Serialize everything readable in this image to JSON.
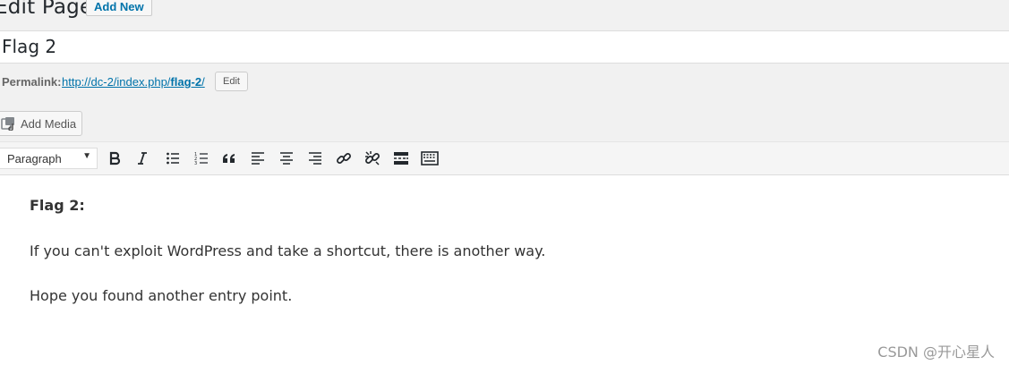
{
  "header": {
    "title": "Edit Page",
    "add_new_label": "Add New"
  },
  "post": {
    "title": "Flag 2"
  },
  "permalink": {
    "label": "Permalink:",
    "url_base": "http://dc-2/index.php/",
    "slug": "flag-2",
    "url_suffix": "/",
    "edit_label": "Edit"
  },
  "media": {
    "add_media_label": "Add Media"
  },
  "toolbar": {
    "format_value": "Paragraph",
    "buttons": [
      "bold-icon",
      "italic-icon",
      "bulleted-list-icon",
      "numbered-list-icon",
      "blockquote-icon",
      "align-left-icon",
      "align-center-icon",
      "align-right-icon",
      "insert-link-icon",
      "remove-link-icon",
      "read-more-icon",
      "toolbar-toggle-icon"
    ]
  },
  "content": {
    "heading": "Flag 2:",
    "paragraph1": "If you can't exploit WordPress and take a shortcut, there is another way.",
    "paragraph2": "Hope you found another entry point."
  },
  "watermark": "CSDN @开心星人",
  "colors": {
    "link": "#0073aa",
    "background": "#f1f1f1",
    "editor_bg": "#ffffff"
  }
}
